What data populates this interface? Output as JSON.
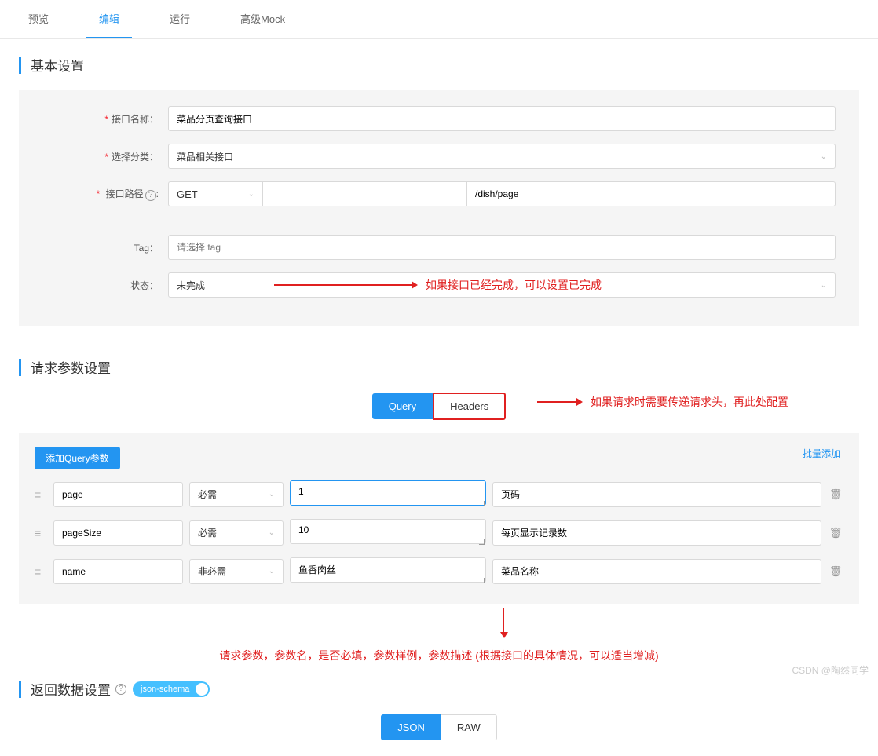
{
  "tabs": {
    "preview": "预览",
    "edit": "编辑",
    "run": "运行",
    "mock": "高级Mock"
  },
  "sections": {
    "basic": "基本设置",
    "request": "请求参数设置",
    "response": "返回数据设置"
  },
  "form": {
    "name_label": "接口名称：",
    "name_value": "菜品分页查询接口",
    "category_label": "选择分类：",
    "category_value": "菜品相关接口",
    "path_label": "接口路径",
    "method": "GET",
    "base_path": "",
    "path_value": "/dish/page",
    "tag_label": "Tag：",
    "tag_placeholder": "请选择 tag",
    "status_label": "状态：",
    "status_value": "未完成"
  },
  "annotations": {
    "status": "如果接口已经完成，可以设置已完成",
    "headers": "如果请求时需要传递请求头，再此处配置",
    "params": "请求参数，参数名，是否必填，参数样例，参数描述   (根据接口的具体情况，可以适当增减)"
  },
  "subtabs": {
    "query": "Query",
    "headers": "Headers"
  },
  "query": {
    "add_btn": "添加Query参数",
    "batch": "批量添加",
    "required_yes": "必需",
    "required_no": "非必需",
    "params": [
      {
        "name": "page",
        "required": "必需",
        "example": "1",
        "desc": "页码"
      },
      {
        "name": "pageSize",
        "required": "必需",
        "example": "10",
        "desc": "每页显示记录数"
      },
      {
        "name": "name",
        "required": "非必需",
        "example": "鱼香肉丝",
        "desc": "菜品名称"
      }
    ]
  },
  "response": {
    "json_schema": "json-schema",
    "tabs": {
      "json": "JSON",
      "raw": "RAW"
    }
  },
  "watermark": "CSDN @陶然同学"
}
